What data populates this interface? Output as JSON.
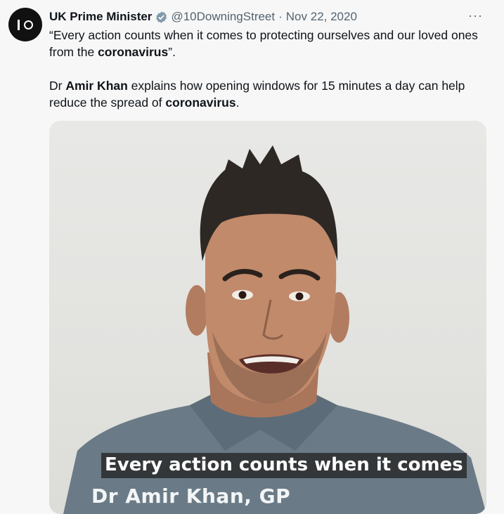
{
  "tweet": {
    "author_name": "UK Prime Minister",
    "handle": "@10DowningStreet",
    "separator": "·",
    "date": "Nov 22, 2020",
    "more_label": "···",
    "avatar_icon": "number-10-logo-icon",
    "verified_icon": "verified-badge-icon",
    "verified_color": "#829aab",
    "paragraph1": {
      "part1": "“Every action counts when it comes to protecting ourselves and our loved ones from the ",
      "bold1": "coronavirus",
      "part2": "”."
    },
    "paragraph2": {
      "part1": "Dr ",
      "bold1": "Amir Khan",
      "part2": " explains how opening windows for 15 minutes a day can help reduce the spread of ",
      "bold2": "coronavirus",
      "part3": "."
    }
  },
  "video": {
    "subtitle": "Every action counts when it comes",
    "lower_third": "Dr Amir Khan, GP"
  }
}
